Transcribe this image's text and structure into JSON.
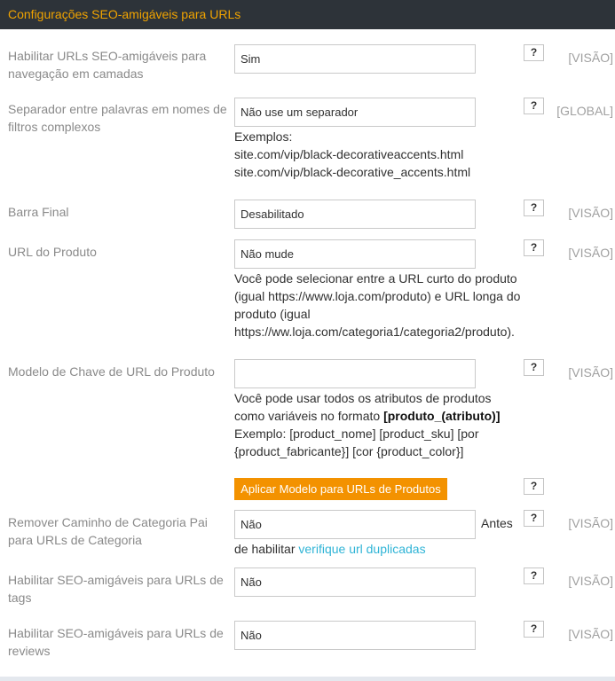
{
  "header": {
    "title": "Configurações SEO-amigáveis para URLs"
  },
  "rows": {
    "layered": {
      "label": "Habilitar URLs SEO-amigáveis para navegação em camadas",
      "value": "Sim",
      "help": "?",
      "scope": "[VISÃO]"
    },
    "separator": {
      "label": "Separador entre palavras em nomes de filtros complexos",
      "value": "Não use um separador",
      "help": "?",
      "scope": "[GLOBAL]",
      "note_line1": "Exemplos:",
      "note_line2": "site.com/vip/black-decorativeaccents.html",
      "note_line3": "site.com/vip/black-decorative_accents.html"
    },
    "trailing": {
      "label": "Barra Final",
      "value": "Desabilitado",
      "help": "?",
      "scope": "[VISÃO]"
    },
    "product_url": {
      "label": "URL do Produto",
      "value": "Não mude",
      "help": "?",
      "scope": "[VISÃO]",
      "note": "Você pode selecionar entre a URL curto do produto (igual https://www.loja.com/produto) e URL longa do produto (igual https://ww.loja.com/categoria1/categoria2/produto)."
    },
    "url_key": {
      "label": "Modelo de Chave de URL do Produto",
      "value": "",
      "help": "?",
      "scope": "[VISÃO]",
      "note_text": "Você pode usar todos os atributos de produtos como variáveis no formato ",
      "note_bold": "[produto_(atributo)]",
      "note_example": "Exemplo: [product_nome] [product_sku] [por {product_fabricante}] [cor {product_color}]"
    },
    "apply": {
      "button_label": "Aplicar Modelo para URLs de Produtos",
      "help": "?"
    },
    "remove_path": {
      "label": "Remover Caminho de Categoria Pai para URLs de Categoria",
      "value": "Não",
      "help": "?",
      "scope": "[VISÃO]",
      "after": "Antes",
      "note_text": "de habilitar ",
      "note_link": "verifique url duplicadas"
    },
    "tags": {
      "label": "Habilitar SEO-amigáveis para URLs de tags",
      "value": "Não",
      "help": "?",
      "scope": "[VISÃO]"
    },
    "reviews": {
      "label": "Habilitar SEO-amigáveis para URLs de reviews",
      "value": "Não",
      "help": "?",
      "scope": "[VISÃO]"
    }
  },
  "colors": {
    "header_bg": "#2d3339",
    "header_text": "#f0a300",
    "button_bg": "#f39200",
    "link": "#2fb4d6"
  }
}
